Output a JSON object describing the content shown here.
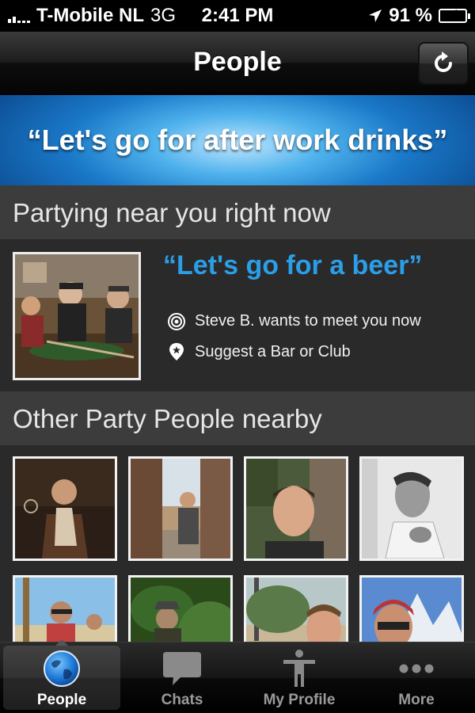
{
  "status_bar": {
    "carrier": "T-Mobile NL",
    "network": "3G",
    "time": "2:41 PM",
    "battery": "91 %",
    "battery_level": 0.91
  },
  "nav": {
    "title": "People",
    "refresh_icon": "refresh-icon"
  },
  "banner": {
    "text": "“Let's go for after work drinks”"
  },
  "partying_section": {
    "header": "Partying near you right now",
    "featured": {
      "quote": "“Let's go for a beer”",
      "meet_text": "Steve B. wants to meet you now",
      "meet_icon": "target-icon",
      "suggest_text": "Suggest a Bar or Club",
      "suggest_icon": "map-pin-star-icon"
    }
  },
  "others_section": {
    "header": "Other Party People nearby",
    "people_count": 8
  },
  "tabs": [
    {
      "label": "People",
      "icon": "globe-icon",
      "active": true
    },
    {
      "label": "Chats",
      "icon": "speech-bubble-icon",
      "active": false
    },
    {
      "label": "My Profile",
      "icon": "person-icon",
      "active": false
    },
    {
      "label": "More",
      "icon": "more-dots-icon",
      "active": false
    }
  ],
  "colors": {
    "accent": "#2b9ee8",
    "section_header_bg": "#3c3c3c",
    "body_bg": "#2a2a2a"
  }
}
